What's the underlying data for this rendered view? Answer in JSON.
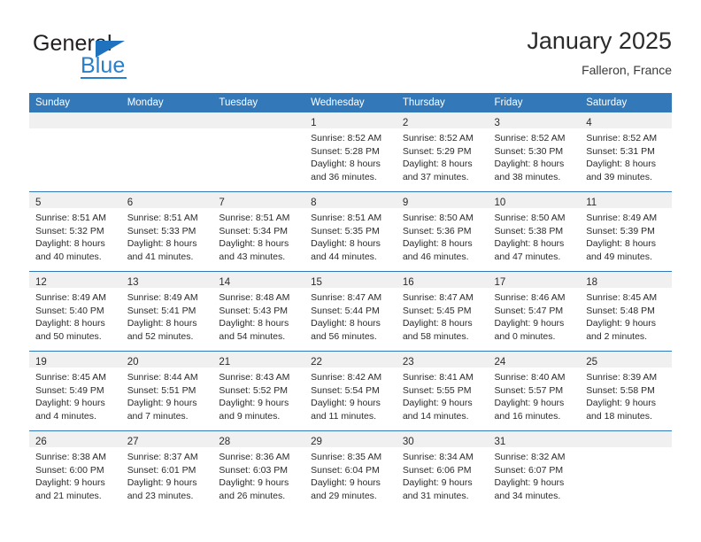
{
  "brand": {
    "name_part1": "General",
    "name_part2": "Blue",
    "accent_color": "#2a7fc9"
  },
  "header": {
    "title": "January 2025",
    "subtitle": "Falleron, France"
  },
  "calendar": {
    "header_bg": "#3379b9",
    "daynum_bg": "#f0f0f0",
    "weekday_headers": [
      "Sunday",
      "Monday",
      "Tuesday",
      "Wednesday",
      "Thursday",
      "Friday",
      "Saturday"
    ],
    "weeks": [
      [
        {
          "day": "",
          "sunrise": "",
          "sunset": "",
          "daylight_line1": "",
          "daylight_line2": ""
        },
        {
          "day": "",
          "sunrise": "",
          "sunset": "",
          "daylight_line1": "",
          "daylight_line2": ""
        },
        {
          "day": "",
          "sunrise": "",
          "sunset": "",
          "daylight_line1": "",
          "daylight_line2": ""
        },
        {
          "day": "1",
          "sunrise": "Sunrise: 8:52 AM",
          "sunset": "Sunset: 5:28 PM",
          "daylight_line1": "Daylight: 8 hours",
          "daylight_line2": "and 36 minutes."
        },
        {
          "day": "2",
          "sunrise": "Sunrise: 8:52 AM",
          "sunset": "Sunset: 5:29 PM",
          "daylight_line1": "Daylight: 8 hours",
          "daylight_line2": "and 37 minutes."
        },
        {
          "day": "3",
          "sunrise": "Sunrise: 8:52 AM",
          "sunset": "Sunset: 5:30 PM",
          "daylight_line1": "Daylight: 8 hours",
          "daylight_line2": "and 38 minutes."
        },
        {
          "day": "4",
          "sunrise": "Sunrise: 8:52 AM",
          "sunset": "Sunset: 5:31 PM",
          "daylight_line1": "Daylight: 8 hours",
          "daylight_line2": "and 39 minutes."
        }
      ],
      [
        {
          "day": "5",
          "sunrise": "Sunrise: 8:51 AM",
          "sunset": "Sunset: 5:32 PM",
          "daylight_line1": "Daylight: 8 hours",
          "daylight_line2": "and 40 minutes."
        },
        {
          "day": "6",
          "sunrise": "Sunrise: 8:51 AM",
          "sunset": "Sunset: 5:33 PM",
          "daylight_line1": "Daylight: 8 hours",
          "daylight_line2": "and 41 minutes."
        },
        {
          "day": "7",
          "sunrise": "Sunrise: 8:51 AM",
          "sunset": "Sunset: 5:34 PM",
          "daylight_line1": "Daylight: 8 hours",
          "daylight_line2": "and 43 minutes."
        },
        {
          "day": "8",
          "sunrise": "Sunrise: 8:51 AM",
          "sunset": "Sunset: 5:35 PM",
          "daylight_line1": "Daylight: 8 hours",
          "daylight_line2": "and 44 minutes."
        },
        {
          "day": "9",
          "sunrise": "Sunrise: 8:50 AM",
          "sunset": "Sunset: 5:36 PM",
          "daylight_line1": "Daylight: 8 hours",
          "daylight_line2": "and 46 minutes."
        },
        {
          "day": "10",
          "sunrise": "Sunrise: 8:50 AM",
          "sunset": "Sunset: 5:38 PM",
          "daylight_line1": "Daylight: 8 hours",
          "daylight_line2": "and 47 minutes."
        },
        {
          "day": "11",
          "sunrise": "Sunrise: 8:49 AM",
          "sunset": "Sunset: 5:39 PM",
          "daylight_line1": "Daylight: 8 hours",
          "daylight_line2": "and 49 minutes."
        }
      ],
      [
        {
          "day": "12",
          "sunrise": "Sunrise: 8:49 AM",
          "sunset": "Sunset: 5:40 PM",
          "daylight_line1": "Daylight: 8 hours",
          "daylight_line2": "and 50 minutes."
        },
        {
          "day": "13",
          "sunrise": "Sunrise: 8:49 AM",
          "sunset": "Sunset: 5:41 PM",
          "daylight_line1": "Daylight: 8 hours",
          "daylight_line2": "and 52 minutes."
        },
        {
          "day": "14",
          "sunrise": "Sunrise: 8:48 AM",
          "sunset": "Sunset: 5:43 PM",
          "daylight_line1": "Daylight: 8 hours",
          "daylight_line2": "and 54 minutes."
        },
        {
          "day": "15",
          "sunrise": "Sunrise: 8:47 AM",
          "sunset": "Sunset: 5:44 PM",
          "daylight_line1": "Daylight: 8 hours",
          "daylight_line2": "and 56 minutes."
        },
        {
          "day": "16",
          "sunrise": "Sunrise: 8:47 AM",
          "sunset": "Sunset: 5:45 PM",
          "daylight_line1": "Daylight: 8 hours",
          "daylight_line2": "and 58 minutes."
        },
        {
          "day": "17",
          "sunrise": "Sunrise: 8:46 AM",
          "sunset": "Sunset: 5:47 PM",
          "daylight_line1": "Daylight: 9 hours",
          "daylight_line2": "and 0 minutes."
        },
        {
          "day": "18",
          "sunrise": "Sunrise: 8:45 AM",
          "sunset": "Sunset: 5:48 PM",
          "daylight_line1": "Daylight: 9 hours",
          "daylight_line2": "and 2 minutes."
        }
      ],
      [
        {
          "day": "19",
          "sunrise": "Sunrise: 8:45 AM",
          "sunset": "Sunset: 5:49 PM",
          "daylight_line1": "Daylight: 9 hours",
          "daylight_line2": "and 4 minutes."
        },
        {
          "day": "20",
          "sunrise": "Sunrise: 8:44 AM",
          "sunset": "Sunset: 5:51 PM",
          "daylight_line1": "Daylight: 9 hours",
          "daylight_line2": "and 7 minutes."
        },
        {
          "day": "21",
          "sunrise": "Sunrise: 8:43 AM",
          "sunset": "Sunset: 5:52 PM",
          "daylight_line1": "Daylight: 9 hours",
          "daylight_line2": "and 9 minutes."
        },
        {
          "day": "22",
          "sunrise": "Sunrise: 8:42 AM",
          "sunset": "Sunset: 5:54 PM",
          "daylight_line1": "Daylight: 9 hours",
          "daylight_line2": "and 11 minutes."
        },
        {
          "day": "23",
          "sunrise": "Sunrise: 8:41 AM",
          "sunset": "Sunset: 5:55 PM",
          "daylight_line1": "Daylight: 9 hours",
          "daylight_line2": "and 14 minutes."
        },
        {
          "day": "24",
          "sunrise": "Sunrise: 8:40 AM",
          "sunset": "Sunset: 5:57 PM",
          "daylight_line1": "Daylight: 9 hours",
          "daylight_line2": "and 16 minutes."
        },
        {
          "day": "25",
          "sunrise": "Sunrise: 8:39 AM",
          "sunset": "Sunset: 5:58 PM",
          "daylight_line1": "Daylight: 9 hours",
          "daylight_line2": "and 18 minutes."
        }
      ],
      [
        {
          "day": "26",
          "sunrise": "Sunrise: 8:38 AM",
          "sunset": "Sunset: 6:00 PM",
          "daylight_line1": "Daylight: 9 hours",
          "daylight_line2": "and 21 minutes."
        },
        {
          "day": "27",
          "sunrise": "Sunrise: 8:37 AM",
          "sunset": "Sunset: 6:01 PM",
          "daylight_line1": "Daylight: 9 hours",
          "daylight_line2": "and 23 minutes."
        },
        {
          "day": "28",
          "sunrise": "Sunrise: 8:36 AM",
          "sunset": "Sunset: 6:03 PM",
          "daylight_line1": "Daylight: 9 hours",
          "daylight_line2": "and 26 minutes."
        },
        {
          "day": "29",
          "sunrise": "Sunrise: 8:35 AM",
          "sunset": "Sunset: 6:04 PM",
          "daylight_line1": "Daylight: 9 hours",
          "daylight_line2": "and 29 minutes."
        },
        {
          "day": "30",
          "sunrise": "Sunrise: 8:34 AM",
          "sunset": "Sunset: 6:06 PM",
          "daylight_line1": "Daylight: 9 hours",
          "daylight_line2": "and 31 minutes."
        },
        {
          "day": "31",
          "sunrise": "Sunrise: 8:32 AM",
          "sunset": "Sunset: 6:07 PM",
          "daylight_line1": "Daylight: 9 hours",
          "daylight_line2": "and 34 minutes."
        },
        {
          "day": "",
          "sunrise": "",
          "sunset": "",
          "daylight_line1": "",
          "daylight_line2": ""
        }
      ]
    ]
  }
}
